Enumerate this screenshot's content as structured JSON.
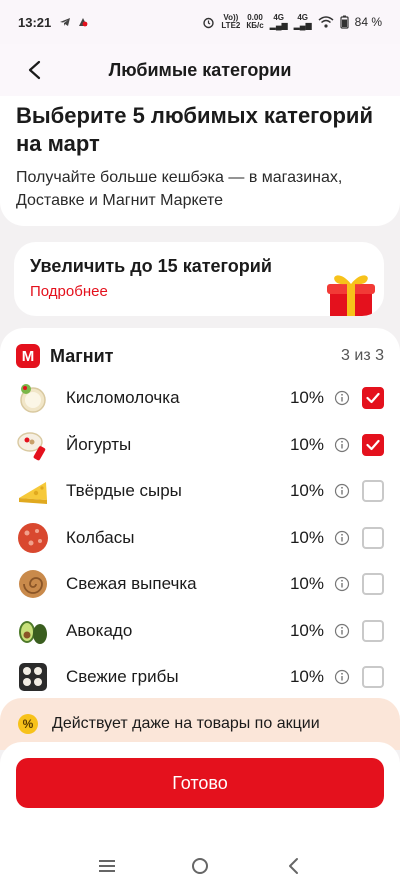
{
  "status_bar": {
    "time": "13:21",
    "network_top": "Vo))",
    "network_bottom": "LTE2",
    "speed_top": "0.00",
    "speed_bottom": "КБ/с",
    "lte1": "4G",
    "lte2": "4G",
    "battery": "84 %"
  },
  "header": {
    "title": "Любимые категории"
  },
  "intro": {
    "title_line1": "Выберите 5 любимых категорий",
    "title_line2": "на март",
    "subtitle_line1": "Получайте больше кешбэка — в магазинах,",
    "subtitle_line2": "Доставке и Магнит Маркете"
  },
  "promo": {
    "title": "Увеличить до 15 категорий",
    "link": "Подробнее"
  },
  "list": {
    "brand_letter": "М",
    "brand_name": "Магнит",
    "counter": "3 из 3",
    "items": [
      {
        "label": "Кисломолочка",
        "percent": "10%",
        "checked": true,
        "icon": "dairy-icon"
      },
      {
        "label": "Йогурты",
        "percent": "10%",
        "checked": true,
        "icon": "yogurt-icon"
      },
      {
        "label": "Твёрдые сыры",
        "percent": "10%",
        "checked": false,
        "icon": "cheese-icon"
      },
      {
        "label": "Колбасы",
        "percent": "10%",
        "checked": false,
        "icon": "sausage-icon"
      },
      {
        "label": "Свежая выпечка",
        "percent": "10%",
        "checked": false,
        "icon": "pastry-icon"
      },
      {
        "label": "Авокадо",
        "percent": "10%",
        "checked": false,
        "icon": "avocado-icon"
      },
      {
        "label": "Свежие грибы",
        "percent": "10%",
        "checked": false,
        "icon": "mushroom-icon"
      }
    ]
  },
  "footer_note": {
    "badge": "%",
    "text": "Действует даже на товары по акции"
  },
  "done_button": {
    "label": "Готово"
  },
  "colors": {
    "accent": "#e4111d",
    "note_bg": "#fbe6d9",
    "badge": "#f7c21a"
  }
}
